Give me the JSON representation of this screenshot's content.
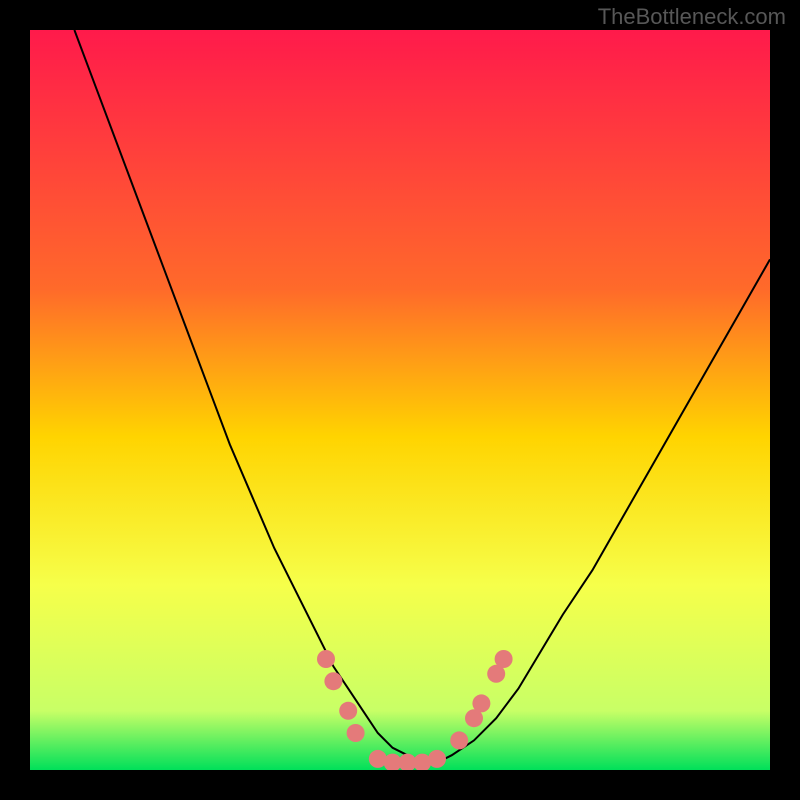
{
  "watermark": "TheBottleneck.com",
  "chart_data": {
    "type": "line",
    "title": "",
    "xlabel": "",
    "ylabel": "",
    "xlim": [
      0,
      100
    ],
    "ylim": [
      0,
      100
    ],
    "gradient_stops": [
      {
        "offset": 0,
        "color": "#ff1a4b"
      },
      {
        "offset": 35,
        "color": "#ff6a2a"
      },
      {
        "offset": 55,
        "color": "#ffd400"
      },
      {
        "offset": 75,
        "color": "#f6ff4a"
      },
      {
        "offset": 92,
        "color": "#c8ff66"
      },
      {
        "offset": 100,
        "color": "#00e05a"
      }
    ],
    "series": [
      {
        "name": "curve",
        "stroke": "#000000",
        "stroke_width": 2,
        "x": [
          6,
          9,
          12,
          15,
          18,
          21,
          24,
          27,
          30,
          33,
          36,
          39,
          41,
          43,
          45,
          47,
          49,
          51,
          53,
          55,
          57,
          60,
          63,
          66,
          69,
          72,
          76,
          80,
          84,
          88,
          92,
          96,
          100
        ],
        "y": [
          100,
          92,
          84,
          76,
          68,
          60,
          52,
          44,
          37,
          30,
          24,
          18,
          14,
          11,
          8,
          5,
          3,
          2,
          1,
          1,
          2,
          4,
          7,
          11,
          16,
          21,
          27,
          34,
          41,
          48,
          55,
          62,
          69
        ]
      }
    ],
    "markers": {
      "Note": "approximate salmon dot markers near curve bottom",
      "color": "#e47a7a",
      "radius": 9,
      "points": [
        {
          "x": 40,
          "y": 15
        },
        {
          "x": 41,
          "y": 12
        },
        {
          "x": 43,
          "y": 8
        },
        {
          "x": 44,
          "y": 5
        },
        {
          "x": 47,
          "y": 1.5
        },
        {
          "x": 49,
          "y": 1
        },
        {
          "x": 51,
          "y": 1
        },
        {
          "x": 53,
          "y": 1
        },
        {
          "x": 55,
          "y": 1.5
        },
        {
          "x": 58,
          "y": 4
        },
        {
          "x": 60,
          "y": 7
        },
        {
          "x": 61,
          "y": 9
        },
        {
          "x": 63,
          "y": 13
        },
        {
          "x": 64,
          "y": 15
        }
      ]
    }
  }
}
